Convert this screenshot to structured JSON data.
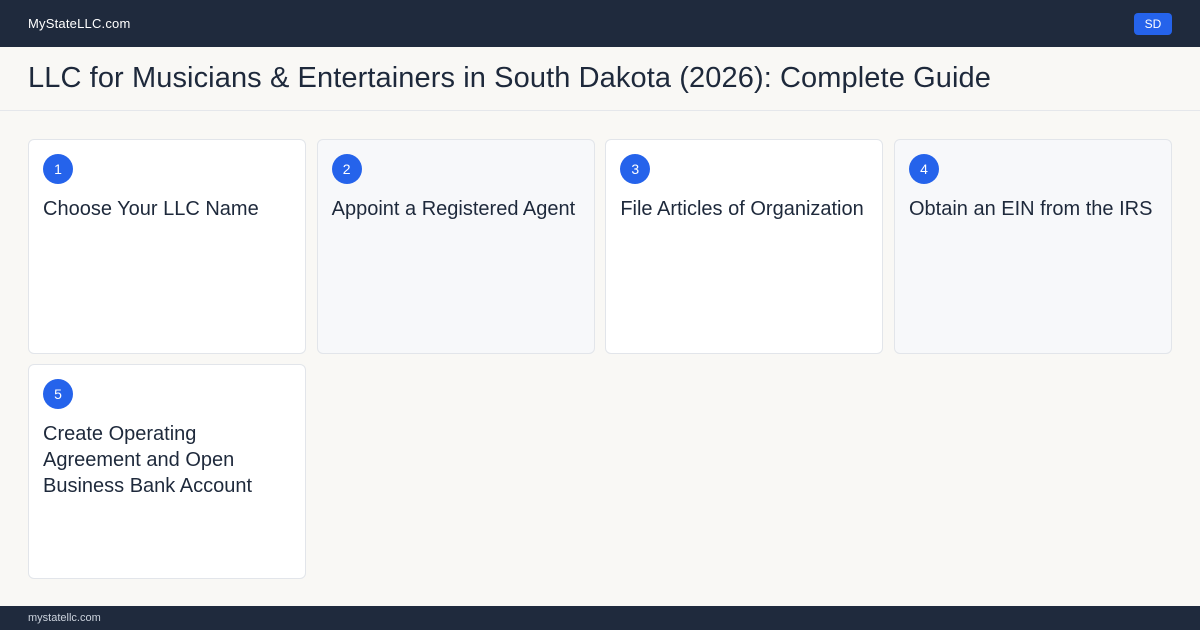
{
  "header": {
    "brand": "MyStateLLC.com",
    "state_badge": "SD"
  },
  "page": {
    "title": "LLC for Musicians & Entertainers in South Dakota (2026): Complete Guide"
  },
  "steps": [
    {
      "number": "1",
      "title": "Choose Your LLC Name"
    },
    {
      "number": "2",
      "title": "Appoint a Registered Agent"
    },
    {
      "number": "3",
      "title": "File Articles of Organization"
    },
    {
      "number": "4",
      "title": "Obtain an EIN from the IRS"
    },
    {
      "number": "5",
      "title": "Create Operating Agreement and Open Business Bank Account"
    }
  ],
  "footer": {
    "domain": "mystatellc.com"
  },
  "colors": {
    "navy": "#1f2a3d",
    "accent": "#2563eb",
    "background": "#f9f8f5"
  }
}
